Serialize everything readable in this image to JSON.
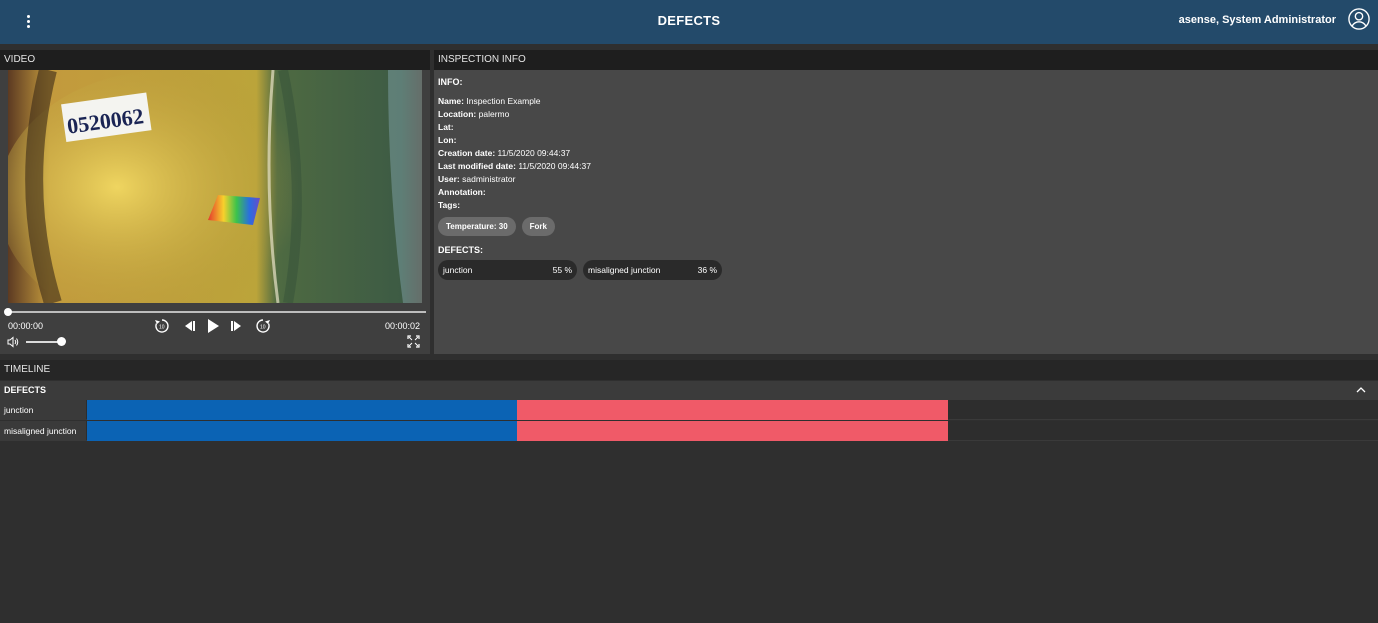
{
  "header": {
    "title": "DEFECTS",
    "user": "asense, System Administrator",
    "icons": {
      "menu": "kebab-menu-icon",
      "user": "user-avatar-icon"
    },
    "background": "#234a6a"
  },
  "video_panel": {
    "title": "VIDEO",
    "frame_label": "0520062",
    "time_current": "00:00:00",
    "time_total": "00:00:02",
    "progress": 0.0,
    "volume": 0.9,
    "icons": [
      "replay-10-icon",
      "step-back-icon",
      "play-icon",
      "step-forward-icon",
      "forward-10-icon",
      "volume-icon",
      "fullscreen-icon"
    ]
  },
  "inspection_panel": {
    "title": "INSPECTION INFO",
    "info_label": "INFO:",
    "fields": [
      {
        "key": "Name:",
        "value": "Inspection Example"
      },
      {
        "key": "Location:",
        "value": "palermo"
      },
      {
        "key": "Lat:",
        "value": ""
      },
      {
        "key": "Lon:",
        "value": ""
      },
      {
        "key": "Creation date:",
        "value": "11/5/2020 09:44:37"
      },
      {
        "key": "Last modified date:",
        "value": "11/5/2020 09:44:37"
      },
      {
        "key": "User:",
        "value": "sadministrator"
      },
      {
        "key": "Annotation:",
        "value": ""
      },
      {
        "key": "Tags:",
        "value": ""
      }
    ],
    "tags": [
      "Temperature: 30",
      "Fork"
    ],
    "defects_label": "DEFECTS:",
    "defects": [
      {
        "name": "junction",
        "confidence": "55 %"
      },
      {
        "name": "misaligned junction",
        "confidence": "36 %"
      }
    ]
  },
  "timeline": {
    "title": "TIMELINE",
    "defects_header": "DEFECTS",
    "rows": [
      {
        "label": "junction"
      },
      {
        "label": "misaligned junction"
      }
    ],
    "colors": {
      "segment_a": "#0b63b4",
      "segment_b": "#f05a68"
    }
  }
}
